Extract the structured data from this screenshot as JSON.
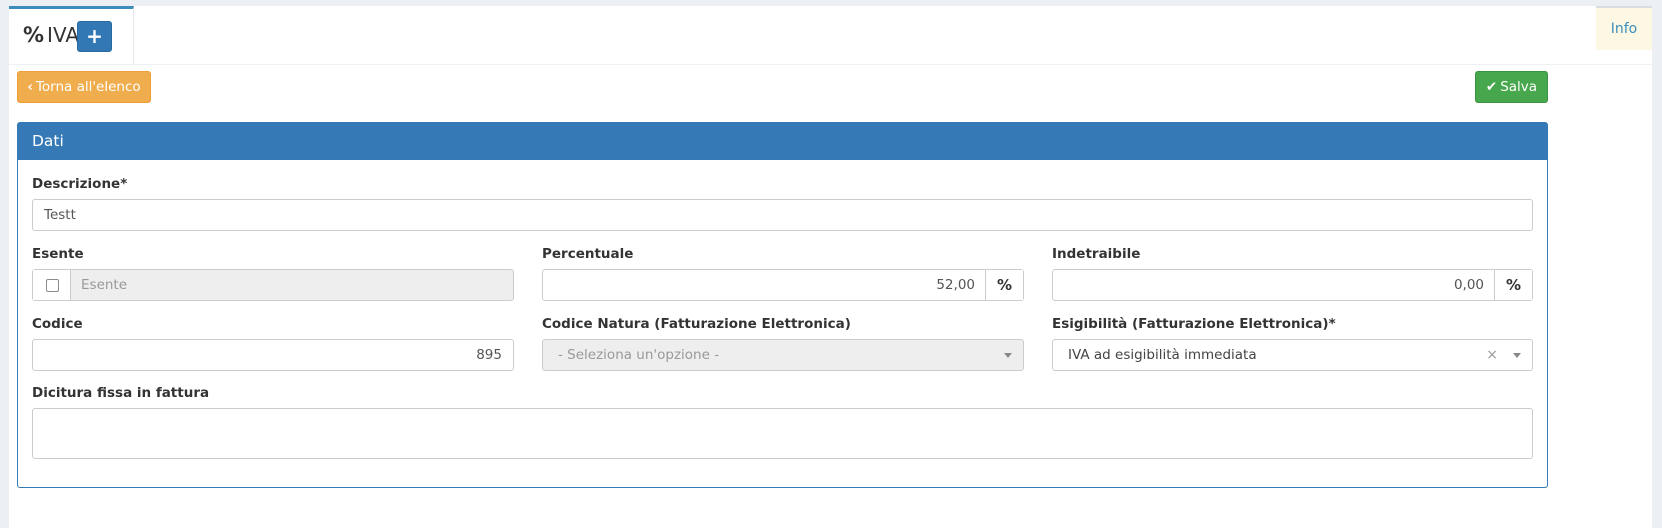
{
  "tabs": {
    "title": "IVA",
    "title_icon": "%",
    "add_icon": "+",
    "info_label": "Info"
  },
  "toolbar": {
    "back_label": "Torna all'elenco",
    "back_icon": "‹",
    "save_label": "Salva",
    "save_icon": "✔"
  },
  "panel": {
    "title": "Dati"
  },
  "form": {
    "descrizione": {
      "label": "Descrizione*",
      "value": "Testt"
    },
    "esente": {
      "label": "Esente",
      "placeholder": "Esente",
      "checked": false
    },
    "percentuale": {
      "label": "Percentuale",
      "value": "52,00",
      "unit": "%"
    },
    "indetraibile": {
      "label": "Indetraibile",
      "value": "0,00",
      "unit": "%"
    },
    "codice": {
      "label": "Codice",
      "value": "895"
    },
    "codice_natura": {
      "label": "Codice Natura (Fatturazione Elettronica)",
      "placeholder": "- Seleziona un'opzione -"
    },
    "esigibilita": {
      "label": "Esigibilità (Fatturazione Elettronica)*",
      "value": "IVA ad esigibilità immediata",
      "clear": "×"
    },
    "dicitura": {
      "label": "Dicitura fissa in fattura",
      "value": ""
    }
  },
  "colors": {
    "primary": "#3579b7",
    "warning": "#f0ad4e",
    "success": "#46a74c",
    "info_bg": "#fdf8e4"
  }
}
